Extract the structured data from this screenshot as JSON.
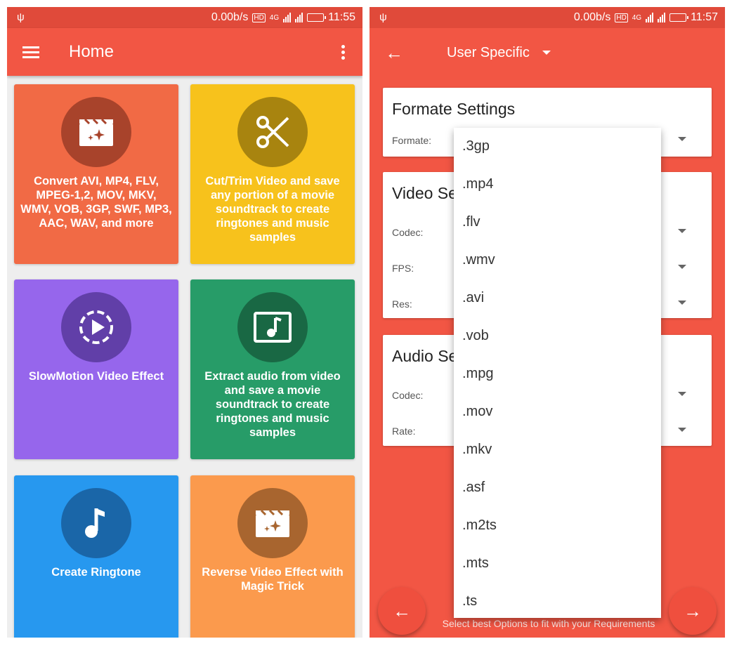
{
  "left": {
    "status": {
      "speed": "0.00b/s",
      "net": "HD",
      "net2": "4G",
      "time": "11:55",
      "battery_level": 1.0
    },
    "appbar": {
      "title": "Home"
    },
    "tiles": [
      {
        "caption": "Convert AVI, MP4, FLV, MPEG-1,2, MOV, MKV, WMV, VOB, 3GP, SWF, MP3, AAC, WAV, and more",
        "icon": "video-clapper-magic-icon",
        "color": "#f16a45",
        "circle": "#a8432b"
      },
      {
        "caption": "Cut/Trim Video and save any portion of a movie soundtrack to create ringtones and music samples",
        "icon": "scissors-icon",
        "color": "#f7c21c",
        "circle": "#a8840f"
      },
      {
        "caption": "SlowMotion Video Effect",
        "icon": "slow-motion-play-icon",
        "color": "#9666ec",
        "circle": "#613fa8"
      },
      {
        "caption": "Extract audio from video and save a movie soundtrack to create ringtones and music samples",
        "icon": "music-image-icon",
        "color": "#279c68",
        "circle": "#196844"
      },
      {
        "caption": "Create Ringtone",
        "icon": "music-note-icon",
        "color": "#2798ef",
        "circle": "#1a66a8"
      },
      {
        "caption": "Reverse Video Effect with Magic Trick",
        "icon": "video-clapper-magic-icon",
        "color": "#fb9a4d",
        "circle": "#a8652f"
      }
    ]
  },
  "right": {
    "status": {
      "speed": "0.00b/s",
      "net": "HD",
      "net2": "4G",
      "time": "11:57",
      "battery_level": 1.0
    },
    "appbar": {
      "spinner_value": "User Specific"
    },
    "cards": {
      "format": {
        "title": "Formate Settings",
        "rows": [
          "Formate:"
        ]
      },
      "video": {
        "title": "Video Se",
        "rows": [
          "Codec:",
          "FPS:",
          "Res:"
        ]
      },
      "audio": {
        "title": "Audio Se",
        "rows": [
          "Codec:",
          "Rate:"
        ]
      }
    },
    "dropdown": [
      ".3gp",
      ".mp4",
      ".flv",
      ".wmv",
      ".avi",
      ".vob",
      ".mpg",
      ".mov",
      ".mkv",
      ".asf",
      ".m2ts",
      ".mts",
      ".ts"
    ],
    "footer": {
      "hint": "Select best Options to fit with your Requirements",
      "prev_icon": "arrow-left-icon",
      "next_icon": "arrow-right-icon"
    }
  }
}
